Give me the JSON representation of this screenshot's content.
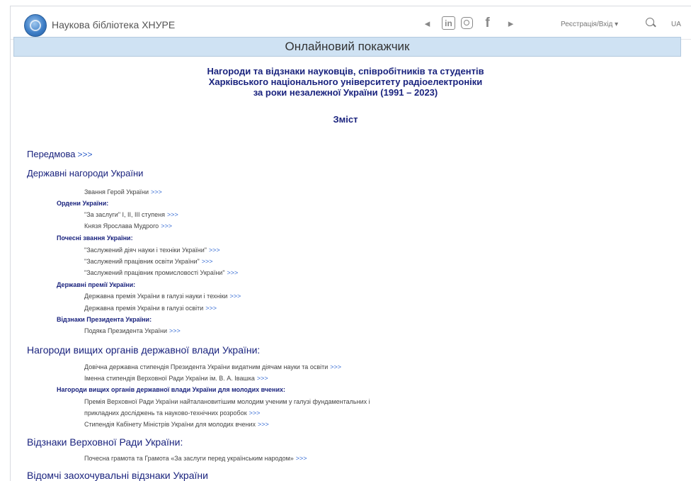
{
  "nav": {
    "brand": "Наукова бібліотека ХНУРЕ",
    "login": "Реєстрація/Вхід ▾",
    "lang": "UA",
    "icons": [
      "telegram-icon",
      "linkedin-icon",
      "instagram-icon",
      "facebook-icon",
      "youtube-icon",
      "search-icon"
    ]
  },
  "page_title": "Онлайновий покажчик",
  "heading": {
    "line1": "Нагороди та відзнаки науковців, співробітників та студентів",
    "line2": "Харківського національного університету радіоелектроніки",
    "line3": "за роки незалежної України (1991 – 2023)"
  },
  "contents_label": "Зміст",
  "arrow": ">>>",
  "sections": {
    "preface": "Передмова",
    "state_awards": "Державні нагороди України",
    "hero": "Звання Герой України",
    "orders": "Ордени України:",
    "order_merit": "\"За заслуги\" I, II, III ступеня",
    "order_yaroslav": "Князя Ярослава Мудрого",
    "honorary_titles": "Почесні звання України:",
    "title_science": "\"Заслужений діяч науки і техніки України\"",
    "title_education": "\"Заслужений працівник освіти України\"",
    "title_industry": "\"Заслужений працівник промисловості України\"",
    "state_prizes": "Державні премії України:",
    "prize_science": "Державна премія України в галузі науки і техніки",
    "prize_education": "Державна премія України в галузі освіти",
    "president_awards": "Відзнаки Президента України:",
    "president_thanks": "Подяка Президента України",
    "higher_bodies": "Нагороди вищих органів державної влади України:",
    "stipend_president": "Довічна державна стипендія Президента України видатним діячам науки та освіти",
    "stipend_rada": "Іменна стипендія Верховної Ради України ім. В. А. Івашка",
    "young_scientists": "Нагороди вищих органів державної влади України для молодих вчених:",
    "prize_rada_line1": "Премія Верховної Ради України найталановитішим молодим ученим у галузі фундаментальних і",
    "prize_rada_line2": "прикладних досліджень та науково-технічних розробок",
    "stipend_cabinet": "Стипендія Кабінету Міністрів України для молодих вчених",
    "rada_distinctions": "Відзнаки Верховної Ради України:",
    "rada_diploma": "Почесна грамота та Грамота «За заслуги перед українським народом»",
    "departmental": "Відомчі заохочувальні відзнаки України"
  }
}
